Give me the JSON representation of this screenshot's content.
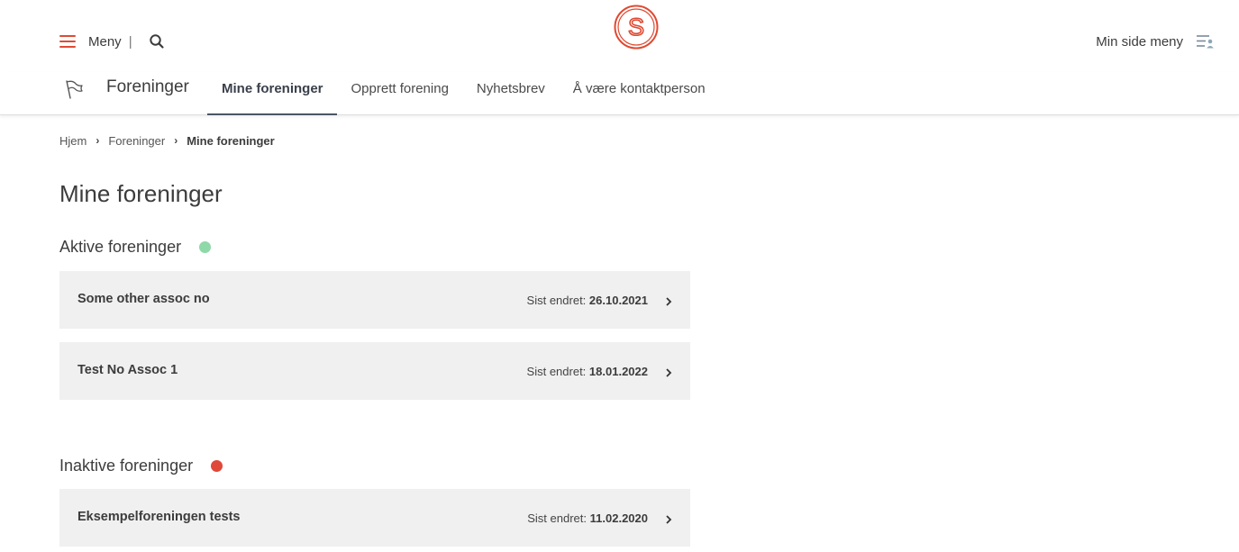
{
  "header": {
    "menu_label": "Meny",
    "menu_separator": "|",
    "logo_letter": "S",
    "min_side_label": "Min side meny",
    "accent_color": "#e04a32"
  },
  "subnav": {
    "section_title": "Foreninger",
    "tabs": [
      {
        "label": "Mine foreninger",
        "active": true
      },
      {
        "label": "Opprett forening",
        "active": false
      },
      {
        "label": "Nyhetsbrev",
        "active": false
      },
      {
        "label": "Å være kontaktperson",
        "active": false
      }
    ]
  },
  "breadcrumb": {
    "items": [
      "Hjem",
      "Foreninger"
    ],
    "current": "Mine foreninger"
  },
  "page": {
    "title": "Mine foreninger"
  },
  "active_group": {
    "title": "Aktive foreninger",
    "status_color": "#8fd8a8",
    "items": [
      {
        "name": "Some other assoc no",
        "meta_label": "Sist endret:",
        "date": "26.10.2021"
      },
      {
        "name": "Test No Assoc 1",
        "meta_label": "Sist endret:",
        "date": "18.01.2022"
      }
    ]
  },
  "inactive_group": {
    "title": "Inaktive foreninger",
    "status_color": "#e0483a",
    "items": [
      {
        "name": "Eksempelforeningen tests",
        "meta_label": "Sist endret:",
        "date": "11.02.2020"
      }
    ]
  }
}
